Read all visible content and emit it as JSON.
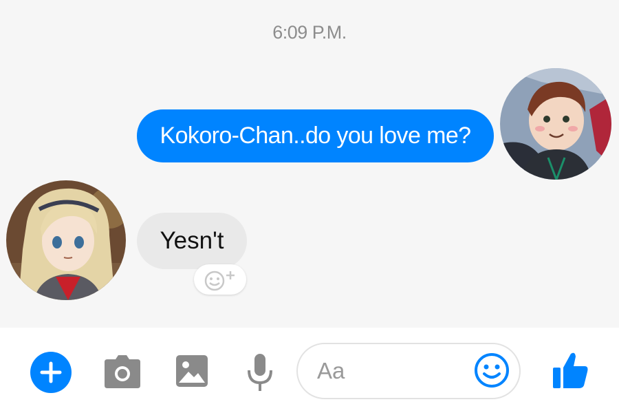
{
  "conversation": {
    "timestamp": "6:09 P.M.",
    "messages": [
      {
        "direction": "outgoing",
        "text": "Kokoro-Chan..do you love me?",
        "avatar": "anime-boy-avatar"
      },
      {
        "direction": "incoming",
        "text": "Yesn't",
        "avatar": "anime-girl-avatar"
      }
    ],
    "reaction_icon": "add-reaction-icon"
  },
  "composer": {
    "placeholder": "Aa",
    "icons": [
      "plus-icon",
      "camera-icon",
      "gallery-icon",
      "microphone-icon",
      "emoji-icon",
      "thumbs-up-icon"
    ]
  },
  "colors": {
    "accent": "#0084ff",
    "outgoing_bubble": "#0084ff",
    "incoming_bubble": "#e9e9e9",
    "icon_gray": "#8a8a8a",
    "background": "#f6f6f6"
  }
}
